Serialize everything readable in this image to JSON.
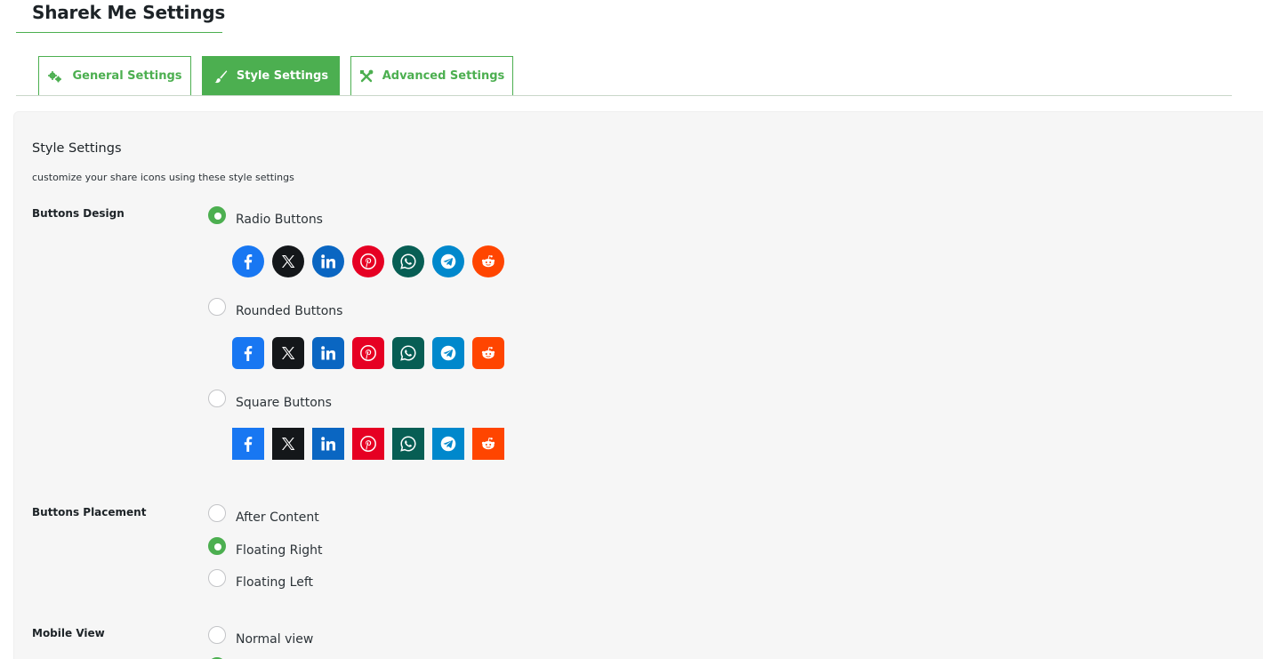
{
  "page": {
    "title": "Sharek Me Settings"
  },
  "tabs": [
    {
      "label": "General Settings",
      "icon": "gears-icon",
      "active": false
    },
    {
      "label": "Style Settings",
      "icon": "paintbrush-icon",
      "active": true
    },
    {
      "label": "Advanced Settings",
      "icon": "tools-icon",
      "active": false
    }
  ],
  "section": {
    "title": "Style Settings",
    "description": "customize your share icons using these style settings"
  },
  "buttons_design": {
    "label": "Buttons Design",
    "options": [
      {
        "label": "Radio Buttons",
        "checked": true,
        "shape": "circle"
      },
      {
        "label": "Rounded Buttons",
        "checked": false,
        "shape": "rounded"
      },
      {
        "label": "Square Buttons",
        "checked": false,
        "shape": "square"
      }
    ],
    "networks": [
      {
        "name": "facebook-icon",
        "color": "#1877f2"
      },
      {
        "name": "x-icon",
        "color": "#14171a"
      },
      {
        "name": "linkedin-icon",
        "color": "#0a66c2"
      },
      {
        "name": "pinterest-icon",
        "color": "#e60023"
      },
      {
        "name": "whatsapp-icon",
        "color": "#075e54"
      },
      {
        "name": "telegram-icon",
        "color": "#0088cc"
      },
      {
        "name": "reddit-icon",
        "color": "#ff4500"
      }
    ]
  },
  "buttons_placement": {
    "label": "Buttons Placement",
    "options": [
      {
        "label": "After Content",
        "checked": false
      },
      {
        "label": "Floating Right",
        "checked": true
      },
      {
        "label": "Floating Left",
        "checked": false
      }
    ]
  },
  "mobile_view": {
    "label": "Mobile View",
    "options": [
      {
        "label": "Normal view",
        "checked": false
      }
    ]
  },
  "colors": {
    "accent": "#4caf50"
  }
}
